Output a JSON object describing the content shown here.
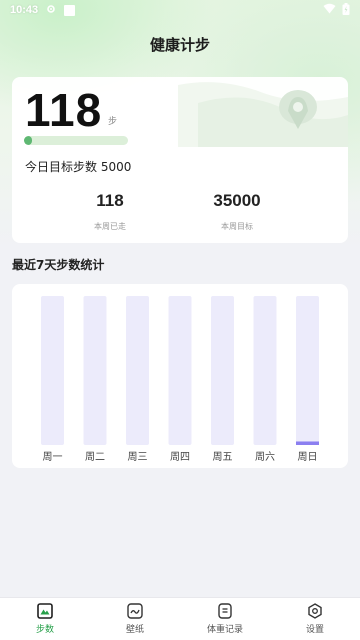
{
  "status_bar": {
    "time": "10:43"
  },
  "header": {
    "title": "健康计步"
  },
  "summary": {
    "steps": "118",
    "unit": "步",
    "progress": 0.024,
    "goal_text": "今日目标步数 5000",
    "stats": [
      {
        "value": "118",
        "label": "本周已走"
      },
      {
        "value": "35000",
        "label": "本周目标"
      }
    ]
  },
  "weekly": {
    "title": "最近7天步数统计"
  },
  "chart_data": {
    "type": "bar",
    "categories": [
      "周一",
      "周二",
      "周三",
      "周四",
      "周五",
      "周六",
      "周日"
    ],
    "values": [
      0,
      0,
      0,
      0,
      0,
      0,
      118
    ],
    "max": 5000
  },
  "colors": {
    "accent": "#27a04a",
    "bar_track": "#ecebfb",
    "bar_fill": "#8b7ff0",
    "progress_fill": "#5fb873"
  },
  "tabs": [
    {
      "label": "步数",
      "icon": "mountain-icon",
      "active": true
    },
    {
      "label": "壁纸",
      "icon": "wallpaper-icon",
      "active": false
    },
    {
      "label": "体重记录",
      "icon": "weight-scale-icon",
      "active": false
    },
    {
      "label": "设置",
      "icon": "settings-hexagon-icon",
      "active": false
    }
  ]
}
